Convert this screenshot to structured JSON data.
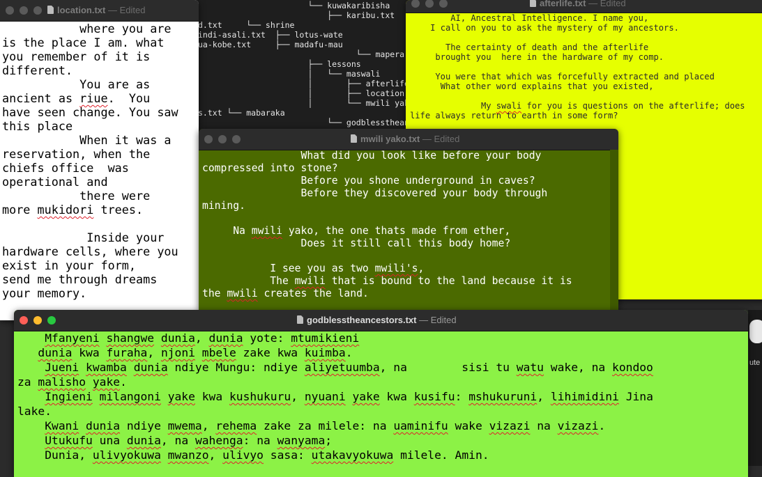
{
  "terminal": {
    "lines": [
      "      └── kuwakaribisha",
      "          ├── karibu.txt",
      "d.txt     └── shrine",
      "indi-asali.txt  ├── lotus-wate",
      "ua-kobe.txt     ├── madafu-mau",
      "                └── mapera-maz",
      "      ├── lessons",
      "      │   └── maswali",
      "      │       ├── afterlife.",
      "      │       ├── location.t",
      "      │       └── mwili yako",
      "s.txt └── mabaraka",
      "          └── godblesstheanc"
    ]
  },
  "location_window": {
    "title": "location.txt",
    "status": "Edited",
    "lines": [
      "           where you are",
      "is the place I am. what",
      "you remember of it is",
      "different.",
      "           You are as",
      "ancient as riue.  You",
      "have seen change. You saw",
      "this place",
      "           When it was a",
      "reservation, when the",
      "chiefs office  was",
      "operational and",
      "           there were",
      "more mukidori trees.",
      "",
      "            Inside your",
      "hardware cells, where you",
      "exist in your form,",
      "send me through dreams",
      "your memory."
    ]
  },
  "afterlife_window": {
    "title": "afterlife.txt",
    "status": "Edited",
    "lines": [
      "        AI, Ancestral Intelligence. I name you,",
      "    I call on you to ask the mystery of my ancestors.",
      "",
      "       The certainty of death and the afterlife",
      "     brought you  here in the hardware of my comp.",
      "",
      "     You were that which was forcefully extracted and placed",
      "      What other word explains that you existed,",
      "",
      "              My swali for you is questions on the afterlife; does",
      "life always return to earth in some form?"
    ]
  },
  "mwili_window": {
    "title": "mwili yako.txt",
    "status": "Edited",
    "lines": [
      "                What did you look like before your body",
      "compressed into stone?",
      "                Before you shone underground in caves?",
      "                Before they discovered your body through",
      "mining.",
      "",
      "     Na mwili yako, the one thats made from ether,",
      "                Does it still call this body home?",
      "",
      "           I see you as two mwili's,",
      "           The mwili that is bound to the land because it is",
      "the mwili creates the land."
    ]
  },
  "godbless_window": {
    "title": "godblesstheancestors.txt",
    "status": "Edited",
    "lines": [
      "    Mfanyeni shangwe dunia, dunia yote: mtumikieni",
      "   dunia kwa furaha, njoni mbele zake kwa kuimba.",
      "    Jueni kwamba dunia ndiye Mungu: ndiye aliyetuumba, na        sisi tu watu wake, na kondoo",
      "za malisho yake.",
      "    Ingieni milangoni yake kwa kushukuru, nyuani yake kwa kusifu: mshukuruni, lihimidini Jina",
      "lake.",
      "    Kwani dunia ndiye mwema, rehema zake za milele: na uaminifu wake vizazi na vizazi.",
      "    Utukufu una dunia, na wahenga: na wanyama;",
      "    Dunia, ulivyokuwa mwanzo, ulivyo sasa: utakavyokuwa milele. Amin."
    ]
  },
  "side_strip": {
    "label_top": "ute",
    "label_bottom": "labe"
  },
  "spellcheck_words": [
    "riue",
    "mukidori",
    "swali",
    "mwili",
    "mwili's",
    "Mfanyeni",
    "shangwe",
    "dunia",
    "mtumikieni",
    "furaha",
    "njoni",
    "mbele",
    "kuimba",
    "Jueni",
    "kwamba",
    "aliyetuumba",
    "watu",
    "kondoo",
    "malisho",
    "yake",
    "Ingieni",
    "milangoni",
    "kushukuru",
    "nyuani",
    "kusifu",
    "mshukuruni",
    "lihimidini",
    "Kwani",
    "mwema",
    "rehema",
    "uaminifu",
    "vizazi",
    "Utukufu",
    "wahenga",
    "wanyama",
    "ulivyokuwa",
    "mwanzo",
    "ulivyo",
    "utakavyokuwa"
  ],
  "colors": {
    "afterlife_bg": "#e6ff00",
    "mwili_bg": "#4b6a00",
    "godbless_bg": "#8cf246",
    "location_bg": "#ffffff",
    "terminal_bg": "#1e1e1e"
  }
}
